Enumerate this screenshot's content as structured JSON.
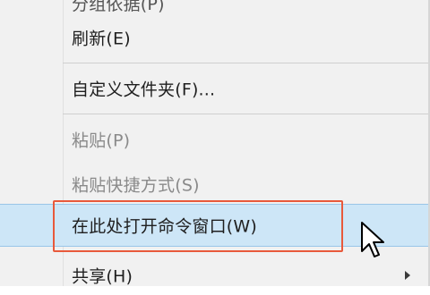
{
  "context_menu": {
    "items": [
      {
        "label": "分组依据(P)",
        "disabled": false
      },
      {
        "label": "刷新(E)",
        "disabled": false
      },
      {
        "label": "自定义文件夹(F)...",
        "disabled": false
      },
      {
        "label": "粘贴(P)",
        "disabled": true
      },
      {
        "label": "粘贴快捷方式(S)",
        "disabled": true
      },
      {
        "label": "在此处打开命令窗口(W)",
        "disabled": false,
        "highlighted": true
      },
      {
        "label": "共享(H)",
        "disabled": false,
        "submenu": true
      }
    ]
  },
  "colors": {
    "highlight_bg": "#cde6f7",
    "highlight_border": "#99c6e8",
    "callout_border": "#e8593b"
  },
  "icons": {
    "submenu_indicator": "chevron-right-icon",
    "pointer": "mouse-cursor-icon"
  }
}
